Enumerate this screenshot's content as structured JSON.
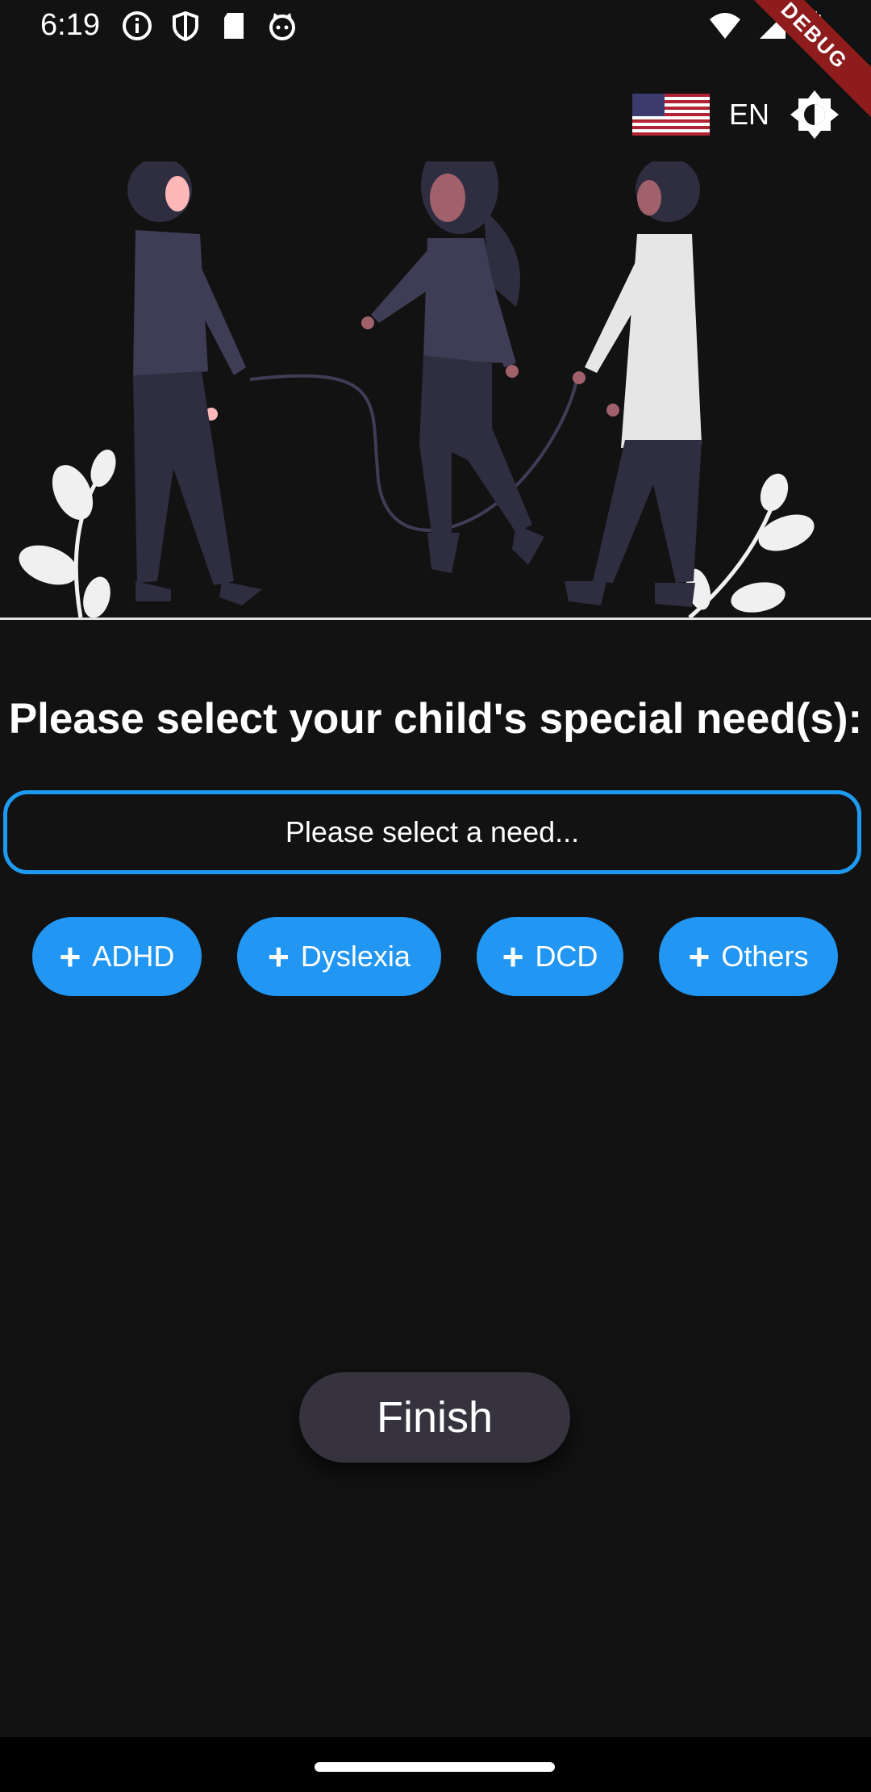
{
  "status_bar": {
    "time": "6:19",
    "left_icons": [
      "info-icon",
      "shield-icon",
      "sd-card-icon",
      "cat-icon"
    ],
    "right_icons": [
      "wifi-icon",
      "signal-icon",
      "battery-icon"
    ]
  },
  "debug_banner": "DEBUG",
  "language": {
    "flag": "us-flag-icon",
    "code": "EN",
    "theme_toggle": "brightness-icon"
  },
  "heading": "Please select your child's special need(s):",
  "select": {
    "placeholder": "Please select a need...",
    "border_color": "#1e9bf0"
  },
  "chips": [
    {
      "label": "ADHD"
    },
    {
      "label": "Dyslexia"
    },
    {
      "label": "DCD"
    },
    {
      "label": "Others"
    }
  ],
  "chip_color": "#2196f3",
  "finish_button": "Finish"
}
